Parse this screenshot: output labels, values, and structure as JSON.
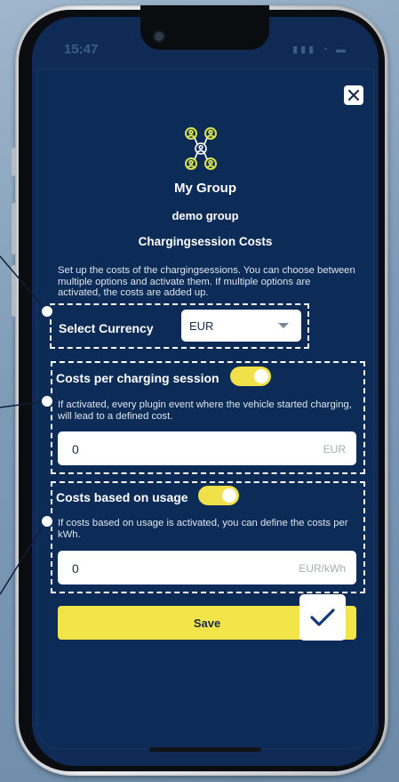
{
  "status_bar": {
    "time": "15:47",
    "icons": "signal wifi battery"
  },
  "header": {
    "close_icon": "close-icon",
    "group_icon": "group-network-icon"
  },
  "group": {
    "title": "My Group",
    "name": "demo group",
    "section_title": "Chargingsession Costs",
    "description": "Set up the costs of the chargingsessions. You can choose between multiple options and activate them. If multiple options are activated, the costs are added up."
  },
  "currency": {
    "label": "Select Currency",
    "value": "EUR"
  },
  "per_session": {
    "label": "Costs per charging session",
    "enabled": true,
    "description": "If activated, every plugin event where the vehicle started charging, will lead to a defined cost.",
    "value": "0",
    "unit": "EUR"
  },
  "usage": {
    "label": "Costs based on usage",
    "enabled": true,
    "description": "If costs based on usage is activated, you can define the costs per kWh.",
    "value": "0",
    "unit": "EUR/kWh"
  },
  "actions": {
    "save_label": "Save",
    "confirm_icon": "checkmark-icon"
  },
  "colors": {
    "background": "#0d2b57",
    "accent": "#f1e54a",
    "text": "#ffffff"
  }
}
